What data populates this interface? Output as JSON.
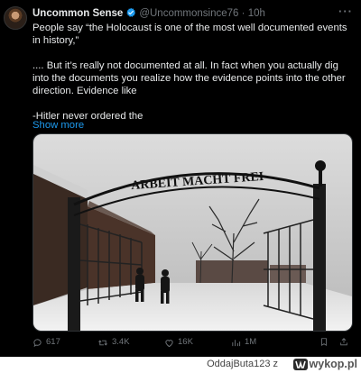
{
  "tweet": {
    "author_name": "Uncommon Sense",
    "handle": "@Uncommonsince76",
    "separator": "·",
    "time": "10h",
    "more_label": "···",
    "text_lines": [
      "People say “the Holocaust is one of the most well documented events in history,”",
      "",
      ".... But it’s really not documented at all.  In fact when you actually dig into the documents you realize how the evidence points into the other direction. Evidence like",
      "",
      "-Hitler never ordered the"
    ],
    "show_more": "Show more",
    "media": {
      "gate_sign": "ARBEIT MACHT FREI"
    },
    "actions": {
      "replies": "617",
      "reposts": "3.4K",
      "likes": "16K",
      "views": "1M"
    }
  },
  "footer": {
    "credit": "OddajButa123  z",
    "site": "wykop.pl"
  },
  "colors": {
    "background": "#000000",
    "text": "#e7e9ea",
    "secondary": "#71767b",
    "link": "#1d9bf0",
    "verified": "#1d9bf0"
  },
  "icons": [
    "verified-badge-icon",
    "more-icon",
    "reply-icon",
    "repost-icon",
    "like-icon",
    "views-icon",
    "bookmark-icon",
    "share-icon",
    "wykop-logo-icon"
  ]
}
